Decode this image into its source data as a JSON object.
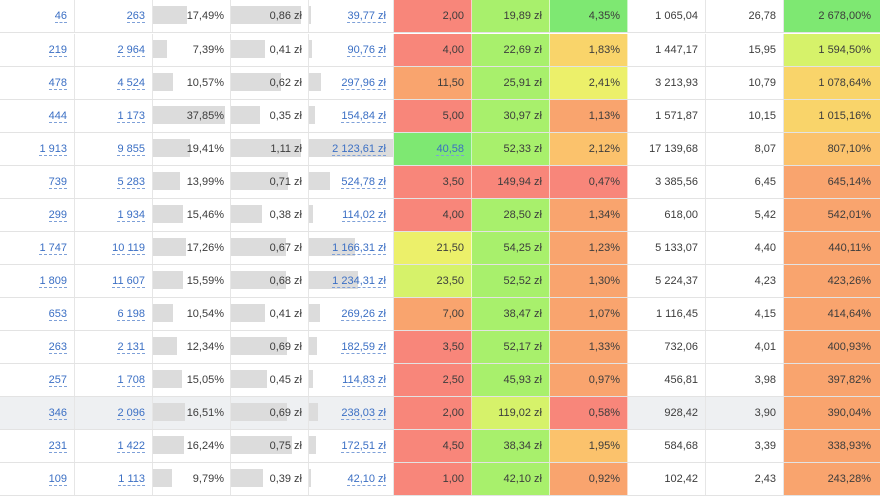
{
  "heat_colors": {
    "red": "#f8867a",
    "orange": "#f9a46e",
    "light_orange": "#fbc26c",
    "yellow_orange": "#f9d46a",
    "yellow": "#ecf06a",
    "yellow_green": "#d6f26a",
    "light_green": "#a8f06c",
    "green": "#7ee872"
  },
  "rows": [
    {
      "c0": "46",
      "c1": "263",
      "c2": "17,49%",
      "c2_fill": 0.47,
      "c3": "0,86 zł",
      "c3_fill": 1.0,
      "c4": "39,77 zł",
      "c4_fill": 0.02,
      "c5": "2,00",
      "c5_color": "#f8867a",
      "c6": "19,89 zł",
      "c6_color": "#a8f06c",
      "c7": "4,35%",
      "c7_color": "#7ee872",
      "c8": "1 065,04",
      "c9": "26,78",
      "c10": "2 678,00%",
      "c10_color": "#7ee872",
      "highlight": false
    },
    {
      "c0": "219",
      "c1": "2 964",
      "c2": "7,39%",
      "c2_fill": 0.2,
      "c3": "0,41 zł",
      "c3_fill": 0.48,
      "c4": "90,76 zł",
      "c4_fill": 0.04,
      "c5": "4,00",
      "c5_color": "#f8867a",
      "c6": "22,69 zł",
      "c6_color": "#a8f06c",
      "c7": "1,83%",
      "c7_color": "#f9d46a",
      "c8": "1 447,17",
      "c9": "15,95",
      "c10": "1 594,50%",
      "c10_color": "#d6f26a",
      "highlight": false
    },
    {
      "c0": "478",
      "c1": "4 524",
      "c2": "10,57%",
      "c2_fill": 0.28,
      "c3": "0,62 zł",
      "c3_fill": 0.72,
      "c4": "297,96 zł",
      "c4_fill": 0.14,
      "c5": "11,50",
      "c5_color": "#f9a46e",
      "c6": "25,91 zł",
      "c6_color": "#a8f06c",
      "c7": "2,41%",
      "c7_color": "#ecf06a",
      "c8": "3 213,93",
      "c9": "10,79",
      "c10": "1 078,64%",
      "c10_color": "#f9d46a",
      "highlight": false
    },
    {
      "c0": "444",
      "c1": "1 173",
      "c2": "37,85%",
      "c2_fill": 1.0,
      "c3": "0,35 zł",
      "c3_fill": 0.41,
      "c4": "154,84 zł",
      "c4_fill": 0.07,
      "c5": "5,00",
      "c5_color": "#f8867a",
      "c6": "30,97 zł",
      "c6_color": "#a8f06c",
      "c7": "1,13%",
      "c7_color": "#f9a46e",
      "c8": "1 571,87",
      "c9": "10,15",
      "c10": "1 015,16%",
      "c10_color": "#f9d46a",
      "highlight": false
    },
    {
      "c0": "1 913",
      "c1": "9 855",
      "c2": "19,41%",
      "c2_fill": 0.51,
      "c3": "1,11 zł",
      "c3_fill": 1.0,
      "c4": "2 123,61 zł",
      "c4_fill": 1.0,
      "c5": "40,58",
      "c5_color": "#7ee872",
      "c5_link": true,
      "c6": "52,33 zł",
      "c6_color": "#a8f06c",
      "c7": "2,12%",
      "c7_color": "#fbc26c",
      "c8": "17 139,68",
      "c9": "8,07",
      "c10": "807,10%",
      "c10_color": "#fbc26c",
      "highlight": false
    },
    {
      "c0": "739",
      "c1": "5 283",
      "c2": "13,99%",
      "c2_fill": 0.37,
      "c3": "0,71 zł",
      "c3_fill": 0.82,
      "c4": "524,78 zł",
      "c4_fill": 0.25,
      "c5": "3,50",
      "c5_color": "#f8867a",
      "c6": "149,94 zł",
      "c6_color": "#f8867a",
      "c7": "0,47%",
      "c7_color": "#f8867a",
      "c8": "3 385,56",
      "c9": "6,45",
      "c10": "645,14%",
      "c10_color": "#f9a46e",
      "highlight": false
    },
    {
      "c0": "299",
      "c1": "1 934",
      "c2": "15,46%",
      "c2_fill": 0.41,
      "c3": "0,38 zł",
      "c3_fill": 0.44,
      "c4": "114,02 zł",
      "c4_fill": 0.05,
      "c5": "4,00",
      "c5_color": "#f8867a",
      "c6": "28,50 zł",
      "c6_color": "#a8f06c",
      "c7": "1,34%",
      "c7_color": "#f9a46e",
      "c8": "618,00",
      "c9": "5,42",
      "c10": "542,01%",
      "c10_color": "#f9a46e",
      "highlight": false
    },
    {
      "c0": "1 747",
      "c1": "10 119",
      "c2": "17,26%",
      "c2_fill": 0.46,
      "c3": "0,67 zł",
      "c3_fill": 0.78,
      "c4": "1 166,31 zł",
      "c4_fill": 0.55,
      "c5": "21,50",
      "c5_color": "#ecf06a",
      "c6": "54,25 zł",
      "c6_color": "#a8f06c",
      "c7": "1,23%",
      "c7_color": "#f9a46e",
      "c8": "5 133,07",
      "c9": "4,40",
      "c10": "440,11%",
      "c10_color": "#f9a46e",
      "highlight": false
    },
    {
      "c0": "1 809",
      "c1": "11 607",
      "c2": "15,59%",
      "c2_fill": 0.41,
      "c3": "0,68 zł",
      "c3_fill": 0.79,
      "c4": "1 234,31 zł",
      "c4_fill": 0.58,
      "c5": "23,50",
      "c5_color": "#d6f26a",
      "c6": "52,52 zł",
      "c6_color": "#a8f06c",
      "c7": "1,30%",
      "c7_color": "#f9a46e",
      "c8": "5 224,37",
      "c9": "4,23",
      "c10": "423,26%",
      "c10_color": "#f9a46e",
      "highlight": false
    },
    {
      "c0": "653",
      "c1": "6 198",
      "c2": "10,54%",
      "c2_fill": 0.28,
      "c3": "0,41 zł",
      "c3_fill": 0.48,
      "c4": "269,26 zł",
      "c4_fill": 0.13,
      "c5": "7,00",
      "c5_color": "#f9a46e",
      "c6": "38,47 zł",
      "c6_color": "#a8f06c",
      "c7": "1,07%",
      "c7_color": "#f9a46e",
      "c8": "1 116,45",
      "c9": "4,15",
      "c10": "414,64%",
      "c10_color": "#f9a46e",
      "highlight": false
    },
    {
      "c0": "263",
      "c1": "2 131",
      "c2": "12,34%",
      "c2_fill": 0.33,
      "c3": "0,69 zł",
      "c3_fill": 0.8,
      "c4": "182,59 zł",
      "c4_fill": 0.09,
      "c5": "3,50",
      "c5_color": "#f8867a",
      "c6": "52,17 zł",
      "c6_color": "#a8f06c",
      "c7": "1,33%",
      "c7_color": "#f9a46e",
      "c8": "732,06",
      "c9": "4,01",
      "c10": "400,93%",
      "c10_color": "#f9a46e",
      "highlight": false
    },
    {
      "c0": "257",
      "c1": "1 708",
      "c2": "15,05%",
      "c2_fill": 0.4,
      "c3": "0,45 zł",
      "c3_fill": 0.52,
      "c4": "114,83 zł",
      "c4_fill": 0.05,
      "c5": "2,50",
      "c5_color": "#f8867a",
      "c6": "45,93 zł",
      "c6_color": "#a8f06c",
      "c7": "0,97%",
      "c7_color": "#f9a46e",
      "c8": "456,81",
      "c9": "3,98",
      "c10": "397,82%",
      "c10_color": "#f9a46e",
      "highlight": false
    },
    {
      "c0": "346",
      "c1": "2 096",
      "c2": "16,51%",
      "c2_fill": 0.44,
      "c3": "0,69 zł",
      "c3_fill": 0.8,
      "c4": "238,03 zł",
      "c4_fill": 0.11,
      "c5": "2,00",
      "c5_color": "#f8867a",
      "c6": "119,02 zł",
      "c6_color": "#d6f26a",
      "c7": "0,58%",
      "c7_color": "#f8867a",
      "c8": "928,42",
      "c9": "3,90",
      "c10": "390,04%",
      "c10_color": "#f9a46e",
      "highlight": true
    },
    {
      "c0": "231",
      "c1": "1 422",
      "c2": "16,24%",
      "c2_fill": 0.43,
      "c3": "0,75 zł",
      "c3_fill": 0.87,
      "c4": "172,51 zł",
      "c4_fill": 0.08,
      "c5": "4,50",
      "c5_color": "#f8867a",
      "c6": "38,34 zł",
      "c6_color": "#a8f06c",
      "c7": "1,95%",
      "c7_color": "#fbc26c",
      "c8": "584,68",
      "c9": "3,39",
      "c10": "338,93%",
      "c10_color": "#f9a46e",
      "highlight": false
    },
    {
      "c0": "109",
      "c1": "1 113",
      "c2": "9,79%",
      "c2_fill": 0.26,
      "c3": "0,39 zł",
      "c3_fill": 0.45,
      "c4": "42,10 zł",
      "c4_fill": 0.02,
      "c5": "1,00",
      "c5_color": "#f8867a",
      "c6": "42,10 zł",
      "c6_color": "#a8f06c",
      "c7": "0,92%",
      "c7_color": "#f9a46e",
      "c8": "102,42",
      "c9": "2,43",
      "c10": "243,28%",
      "c10_color": "#f9a46e",
      "highlight": false
    }
  ]
}
